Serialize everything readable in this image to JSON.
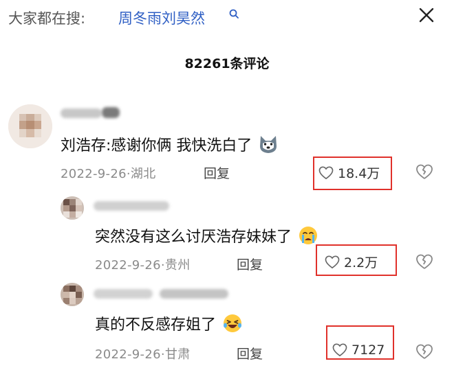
{
  "search": {
    "prefix": "大家都在搜:",
    "query": "周冬雨刘昊然"
  },
  "comments_header": "82261条评论",
  "comments": [
    {
      "text": "刘浩存:感谢你俩 我快洗白了",
      "emoji": "husky-dog-emoji",
      "date": "2022-9-26",
      "location": "湖北",
      "reply_label": "回复",
      "likes": "18.4万"
    },
    {
      "text": "突然没有这么讨厌浩存妹妹了",
      "emoji": "crying-face-emoji",
      "date": "2022-9-26",
      "location": "贵州",
      "reply_label": "回复",
      "likes": "2.2万"
    },
    {
      "text": "真的不反感存姐了",
      "emoji": "laughing-tears-emoji",
      "date": "2022-9-26",
      "location": "甘肃",
      "reply_label": "回复",
      "likes": "7127"
    }
  ],
  "colors": {
    "query_link": "#2f5fc4",
    "highlight_box": "#e0302a",
    "meta_gray": "#8a8a8a"
  }
}
